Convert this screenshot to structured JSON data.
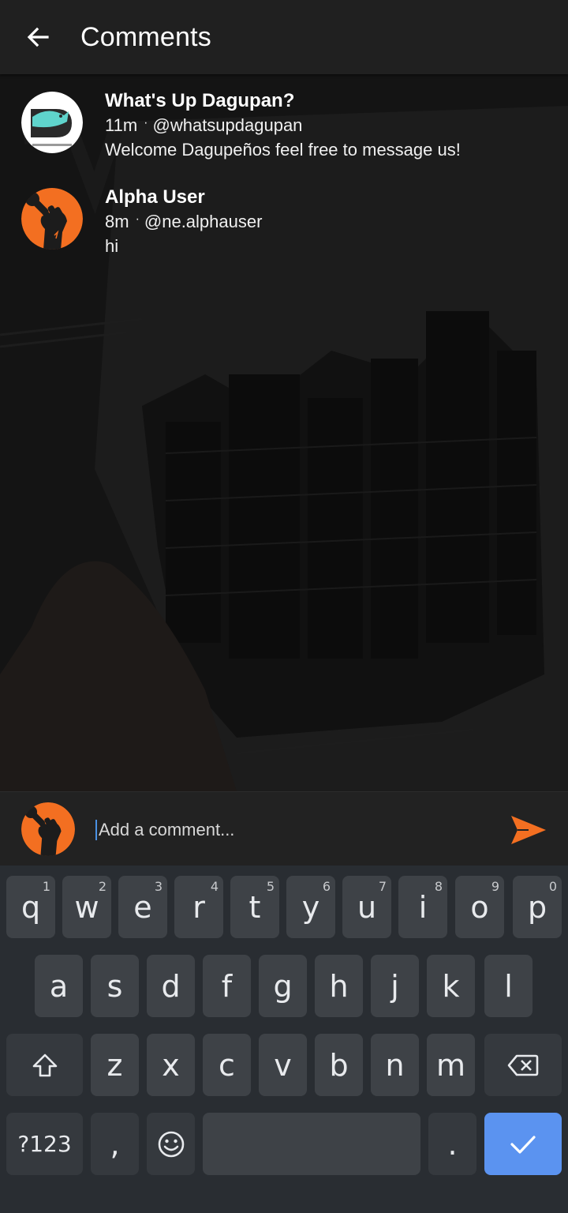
{
  "header": {
    "title": "Comments",
    "back_icon": "arrow-back-icon"
  },
  "comments": [
    {
      "author": "What's Up Dagupan?",
      "time": "11m",
      "separator": "·",
      "handle": "@whatsupdagupan",
      "text": "Welcome Dagupeños feel free to message us!",
      "avatar_icon": "fish-logo-avatar"
    },
    {
      "author": "Alpha User",
      "time": "8m",
      "separator": "·",
      "handle": "@ne.alphauser",
      "text": "hi",
      "avatar_icon": "raised-fist-microphone-avatar"
    }
  ],
  "composer": {
    "placeholder": "Add a comment...",
    "send_icon": "send-icon",
    "accent_color": "#f36f21"
  },
  "keyboard": {
    "row1": [
      {
        "key": "q",
        "hint": "1"
      },
      {
        "key": "w",
        "hint": "2"
      },
      {
        "key": "e",
        "hint": "3"
      },
      {
        "key": "r",
        "hint": "4"
      },
      {
        "key": "t",
        "hint": "5"
      },
      {
        "key": "y",
        "hint": "6"
      },
      {
        "key": "u",
        "hint": "7"
      },
      {
        "key": "i",
        "hint": "8"
      },
      {
        "key": "o",
        "hint": "9"
      },
      {
        "key": "p",
        "hint": "0"
      }
    ],
    "row2": [
      "a",
      "s",
      "d",
      "f",
      "g",
      "h",
      "j",
      "k",
      "l"
    ],
    "row3": [
      "z",
      "x",
      "c",
      "v",
      "b",
      "n",
      "m"
    ],
    "symbols_label": "?123",
    "comma": ",",
    "period": ".",
    "shift_icon": "shift-icon",
    "backspace_icon": "backspace-icon",
    "emoji_icon": "emoji-icon",
    "done_icon": "checkmark-icon",
    "done_color": "#5b93f0"
  }
}
